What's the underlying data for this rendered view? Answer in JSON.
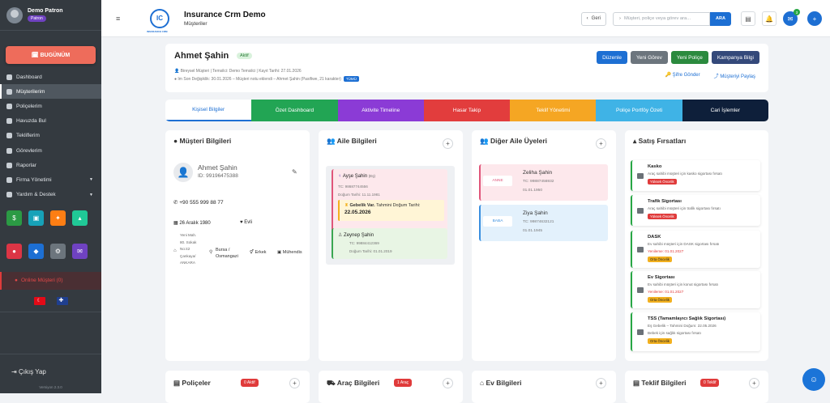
{
  "sidebar": {
    "user_name": "Demo Patron",
    "role": "Patron",
    "today_label": "🗓 BUGÜNÜM",
    "menu": [
      {
        "label": "Dashboard",
        "active": false,
        "chev": false
      },
      {
        "label": "Müşterilerim",
        "active": true,
        "chev": false
      },
      {
        "label": "Poliçelerim",
        "active": false,
        "chev": false
      },
      {
        "label": "Havuzda Bul",
        "active": false,
        "chev": false
      },
      {
        "label": "Tekliflerim",
        "active": false,
        "chev": false
      },
      {
        "label": "Görevlerim",
        "active": false,
        "chev": false
      },
      {
        "label": "Raporlar",
        "active": false,
        "chev": false
      },
      {
        "label": "Firma Yönetimi",
        "active": false,
        "chev": true
      },
      {
        "label": "Yardım & Destek",
        "active": false,
        "chev": true
      }
    ],
    "online_label": "Online Müşteri (0)",
    "logout_label": "Çıkış Yap",
    "version": "Versiyon 2.3.0",
    "tile_colors": [
      "#2b9a44",
      "#17a2b8",
      "#fd7e14",
      "#20c997",
      "#dc3545",
      "#1d6fd3",
      "#6c757d",
      "#6f42c1"
    ],
    "tile_icons": [
      "$",
      "▣",
      "✦",
      "▴",
      "●",
      "◆",
      "⚙",
      "✉"
    ]
  },
  "topbar": {
    "title": "Insurance Crm Demo",
    "subtitle": "Müşteriler",
    "back_label": "Geri",
    "search_placeholder": "Müşteri, poliçe veya görev ara...",
    "search_button": "ARA",
    "notif_count": "3",
    "logo_text": "IC",
    "logo_sub": "INSURANCE CRM"
  },
  "customer": {
    "name": "Ahmet Şahin",
    "status": "Aktif",
    "meta1": "Bireysel Müşteri | Temsilci: Demo Temsilci | Kayıt Tarihi: 27.01.2026",
    "meta2": "Im Son Değişiklik: 30.01.2026 – Müşteri notu eklendi – Ahmet Şahin (Pasifiwe, 21 karakter)",
    "meta2_chip": "TÜMÜ",
    "buttons": [
      {
        "label": "Düzenle",
        "color": "#1d6fd3"
      },
      {
        "label": "Yeni Görev",
        "color": "#6c757d"
      },
      {
        "label": "Yeni Poliçe",
        "color": "#2b8a3e"
      },
      {
        "label": "Kampanya Bilgi",
        "color": "#34497a"
      }
    ],
    "links": [
      "Şifre Gönder",
      "Müşteriyi Paylaş"
    ]
  },
  "tabs": [
    {
      "label": "Kişisel Bilgiler",
      "color": "#ffffff"
    },
    {
      "label": "Özet Dashboard",
      "color": "#22a554"
    },
    {
      "label": "Aktivite Timeline",
      "color": "#8b3bd6"
    },
    {
      "label": "Hasar Takip",
      "color": "#e23d3d"
    },
    {
      "label": "Teklif Yönetimi",
      "color": "#f5a623"
    },
    {
      "label": "Poliçe Portföy Özeti",
      "color": "#3fb3e6"
    },
    {
      "label": "Cari İşlemler",
      "color": "#0e1f3a"
    }
  ],
  "musteri": {
    "title": "Müşteri Bilgileri",
    "name": "Ahmet Şahin",
    "id": "ID: 99196475388",
    "phone": "+90 555 999 88 77",
    "birth": "26 Aralık 1980",
    "marital": "Evli",
    "address": "Yeni Mah. 80. Sokak No:42 Çankaya/ ANKARA",
    "city": "Bursa / Osmangazi",
    "gender": "Erkek",
    "job": "Mühendis"
  },
  "aile": {
    "title": "Aile Bilgileri",
    "spouse_name": "Ayşe Şahin",
    "spouse_tag": "(Eş)",
    "spouse_tc": "TC: 98687744556",
    "spouse_birth": "Doğum Tarihi: 11.11.1981",
    "preg_label": "Gebelik Var.",
    "preg_text": "Tahmini Doğum Tarihi:",
    "preg_date": "22.05.2026",
    "child_name": "Zeynep Şahin",
    "child_tc": "TC: 99884412369",
    "child_birth": "Doğum Tarihi: 01.01.2019"
  },
  "diger": {
    "title": "Diğer Aile Üyeleri",
    "members": [
      {
        "role": "ANNE",
        "name": "Zeliha Şahin",
        "tc": "TC: 99887456932",
        "date": "01.01.1950"
      },
      {
        "role": "BABA",
        "name": "Ziya Şahin",
        "tc": "TC: 99874632121",
        "date": "01.01.1945"
      }
    ]
  },
  "satis": {
    "title": "Satış Fırsatları",
    "items": [
      {
        "title": "Kasko",
        "desc": "Araç sahibi müşteri için kasko sigortası fırsatı",
        "due": "",
        "priority": "Yüksek Öncelik",
        "pcolor": "#e03b3b"
      },
      {
        "title": "Trafik Sigortası",
        "desc": "Araç sahibi müşteri için trafik sigortası fırsatı",
        "due": "",
        "priority": "Yüksek Öncelik",
        "pcolor": "#e03b3b"
      },
      {
        "title": "DASK",
        "desc": "Ev sahibi müşteri için DASK sigortası fırsatı",
        "due": "Yenileme: 01.01.2027",
        "priority": "Orta Öncelik",
        "pcolor": "#f2b01e"
      },
      {
        "title": "Ev Sigortası",
        "desc": "Ev sahibi müşteri için konut sigortası fırsatı",
        "due": "Yenileme: 01.01.2027",
        "priority": "Orta Öncelik",
        "pcolor": "#f2b01e"
      },
      {
        "title": "TSS (Tamamlayıcı Sağlık Sigortası)",
        "desc": "Eş Gebelik – Tahmini Doğum: 22.05.2026",
        "desc2": "Bebek için sağlık sigortası fırsatı",
        "due": "",
        "priority": "Orta Öncelik",
        "pcolor": "#f2b01e"
      }
    ]
  },
  "bottom": [
    {
      "title": "Poliçeler",
      "badge": "0 Aktif"
    },
    {
      "title": "Araç Bilgileri",
      "badge": "1 Araç"
    },
    {
      "title": "Ev Bilgileri",
      "badge": ""
    },
    {
      "title": "Teklif Bilgileri",
      "badge": "0 Teklif"
    }
  ]
}
